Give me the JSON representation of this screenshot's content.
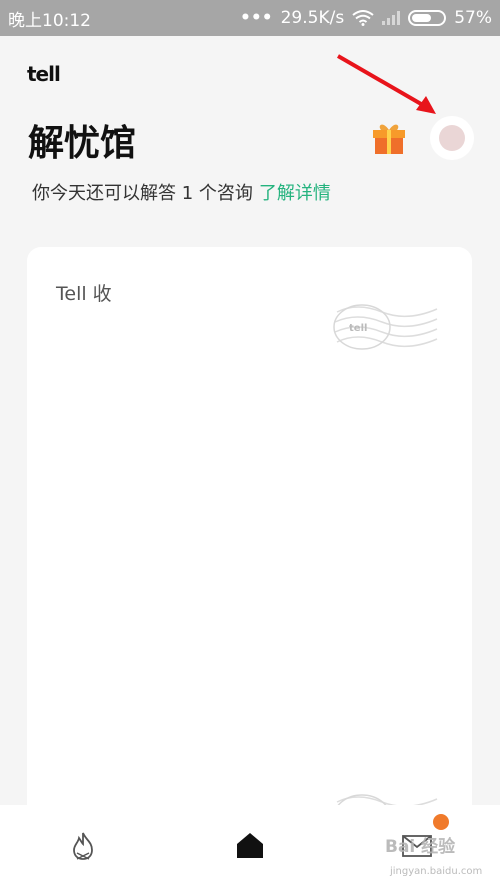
{
  "status_bar": {
    "time": "晚上10:12",
    "speed": "29.5K/s",
    "battery": "57%"
  },
  "app": {
    "logo_text": "tell",
    "page_title": "解忧馆",
    "subtitle": "你今天还可以解答 1 个咨询",
    "learn_more": "了解详情"
  },
  "card": {
    "title": "Tell 收",
    "stamp_text": "tell"
  },
  "nav": {
    "items": [
      {
        "icon": "fire-icon"
      },
      {
        "icon": "home-icon"
      },
      {
        "icon": "mail-icon"
      }
    ]
  },
  "watermark": {
    "text": "Bai 经验",
    "url": "jingyan.baidu.com"
  },
  "colors": {
    "accent_green": "#24b37e",
    "badge_orange": "#f07a2b",
    "arrow_red": "#e8141b"
  }
}
